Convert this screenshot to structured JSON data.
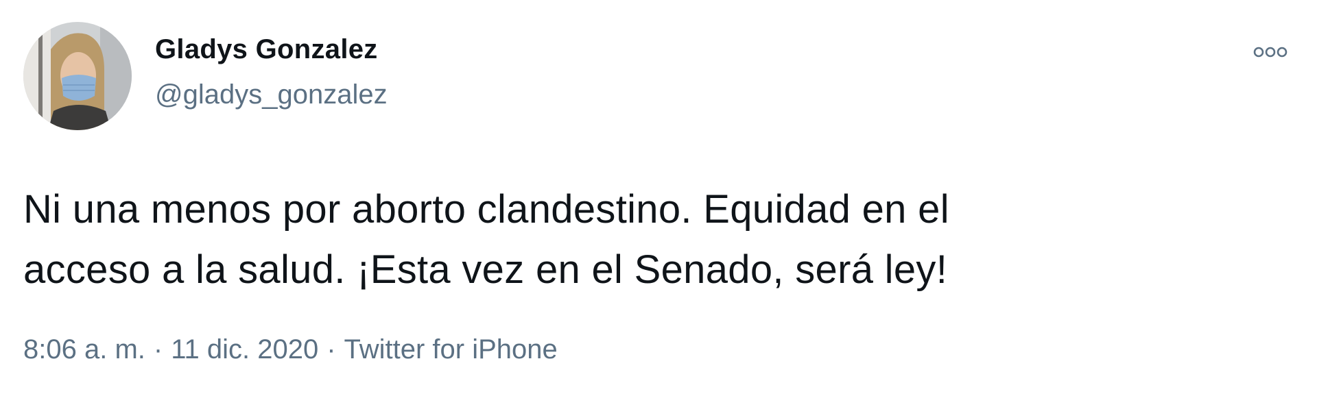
{
  "author": {
    "display_name": "Gladys Gonzalez",
    "handle": "@gladys_gonzalez",
    "avatar_icon": "profile-photo"
  },
  "menu": {
    "more_icon": "more-dots-icon"
  },
  "tweet": {
    "text_lines": [
      "Ni una menos por aborto clandestino. Equidad en el",
      "acceso a la salud. ¡Esta vez en el Senado, será ley!"
    ]
  },
  "meta": {
    "time": "8:06 a. m.",
    "separator": "·",
    "date": "11 dic. 2020",
    "source": "Twitter for iPhone"
  },
  "colors": {
    "text": "#0f1419",
    "secondary": "#5b7083",
    "background": "#ffffff"
  }
}
